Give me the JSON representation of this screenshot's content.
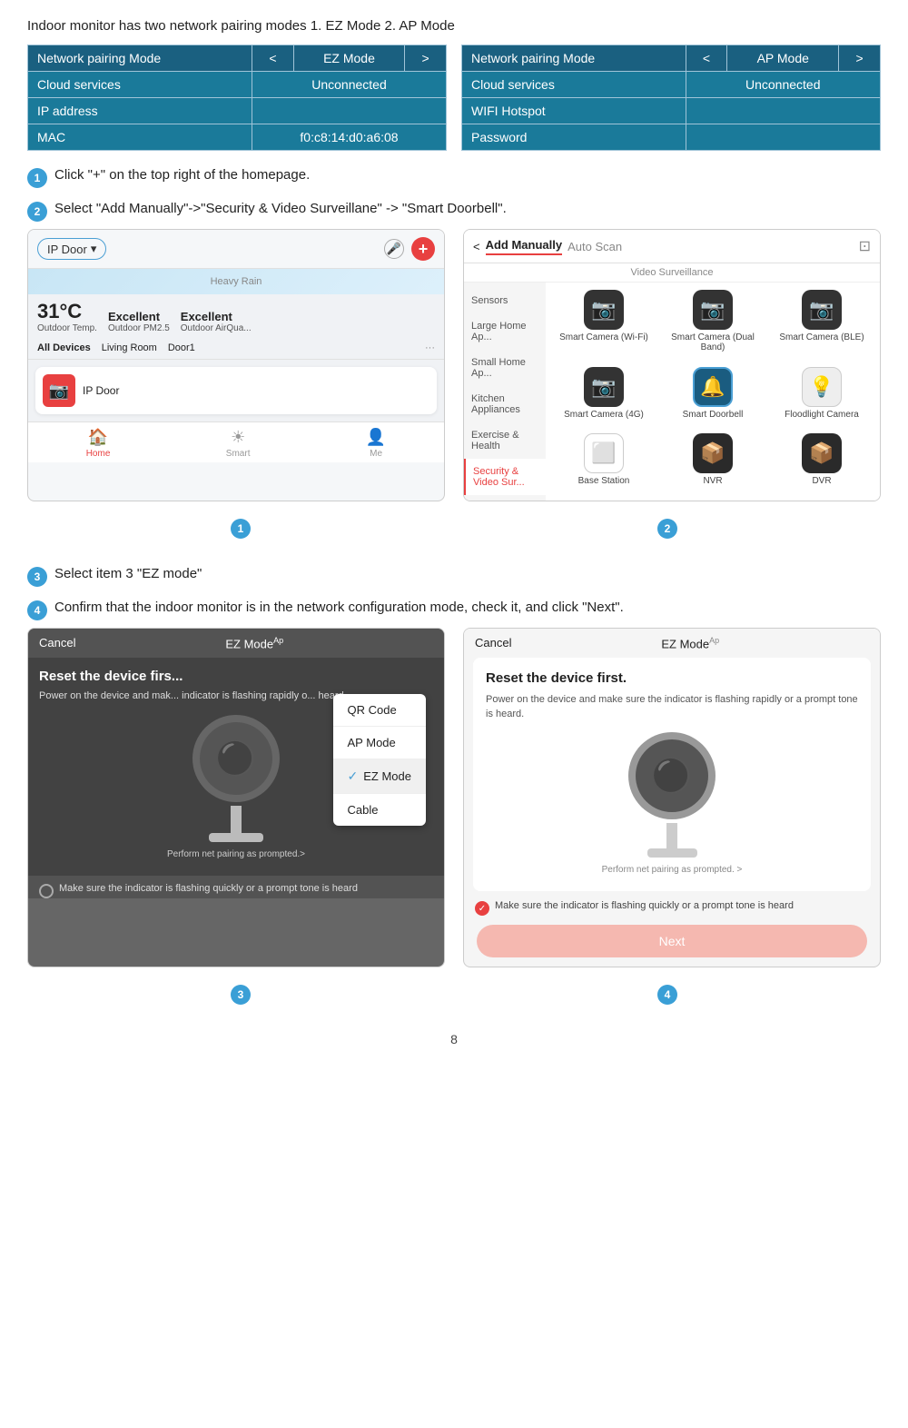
{
  "intro": {
    "text": "Indoor monitor has two network pairing modes 1. EZ Mode  2. AP Mode"
  },
  "table_ez": {
    "row1_label": "Network pairing Mode",
    "row1_left": "<",
    "row1_value": "EZ Mode",
    "row1_right": ">",
    "row2_label": "Cloud services",
    "row2_value": "Unconnected",
    "row3_label": "IP address",
    "row3_value": "",
    "row4_label": "MAC",
    "row4_value": "f0:c8:14:d0:a6:08"
  },
  "table_ap": {
    "row1_label": "Network pairing Mode",
    "row1_left": "<",
    "row1_value": "AP Mode",
    "row1_right": ">",
    "row2_label": "Cloud services",
    "row2_value": "Unconnected",
    "row3_label": "WIFI Hotspot",
    "row3_value": "",
    "row4_label": "Password",
    "row4_value": ""
  },
  "steps": {
    "step1": "Click \"+\" on the top right of the homepage.",
    "step2": "Select \"Add Manually\"->\"Security & Video Surveillane\" -> \"Smart Doorbell\".",
    "step3": "Select item 3 \"EZ mode\"",
    "step4": "Confirm that the indoor monitor is in the network configuration mode, check it, and click \"Next\"."
  },
  "app1": {
    "title": "IP Door",
    "dropdown": "▾",
    "weather_label": "Heavy Rain",
    "temp": "31°C",
    "temp_label": "Outdoor Temp.",
    "pm_val": "Excellent",
    "pm_label": "Outdoor PM2.5",
    "air_val": "Excellent",
    "air_label": "Outdoor AirQua...",
    "tab_all": "All Devices",
    "tab_room": "Living Room",
    "tab_door": "Door1",
    "dots": "···",
    "device_name": "IP Door",
    "nav_home": "Home",
    "nav_smart": "Smart",
    "nav_me": "Me"
  },
  "app2": {
    "back": "<",
    "tab_manual": "Add Manually",
    "tab_scan": "Auto Scan",
    "scan_icon": "⊡",
    "section_video": "Video Surveillance",
    "cat1": "Sensors",
    "cat2": "Large Home Ap...",
    "cat3": "Small Home Ap...",
    "cat4": "Kitchen Appliances",
    "cat5": "Exercise & Health",
    "cat6": "Security & Video Sur...",
    "dev1_name": "Smart Camera (Wi-Fi)",
    "dev2_name": "Smart Camera (Dual Band)",
    "dev3_name": "Smart Camera (BLE)",
    "dev4_name": "Smart Camera (4G)",
    "dev5_name": "Smart Doorbell",
    "dev6_name": "Floodlight Camera",
    "dev7_name": "Base Station",
    "dev8_name": "NVR",
    "dev9_name": "DVR"
  },
  "modal3": {
    "cancel": "Cancel",
    "title": "EZ Mode",
    "sup": "Ap",
    "heading": "Reset the device firs...",
    "body": "Power on the device and mak... indicator is flashing rapidly o... heard.",
    "mode1": "QR Code",
    "mode2": "AP Mode",
    "mode3": "EZ Mode",
    "mode4": "Cable",
    "prompt": "Perform net pairing as prompted.>",
    "checkbox_text": "Make sure the indicator is flashing quickly or a prompt tone is heard"
  },
  "modal4": {
    "cancel": "Cancel",
    "title": "EZ Mode",
    "sup": "Ap",
    "heading": "Reset the device first.",
    "body": "Power on the device and make sure the indicator is flashing rapidly or a prompt tone is heard.",
    "prompt": "Perform net pairing as prompted. >",
    "checkbox_text": "Make sure the indicator is flashing quickly or a prompt tone is heard",
    "next_btn": "Next"
  },
  "page_number": "8"
}
